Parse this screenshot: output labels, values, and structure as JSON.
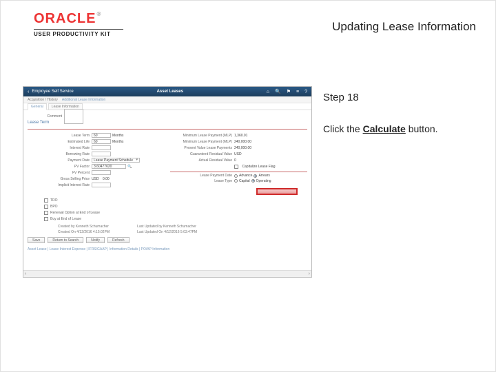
{
  "brand": {
    "name": "ORACLE",
    "tm": "®",
    "subtitle": "USER PRODUCTIVITY KIT"
  },
  "doc_title": "Updating Lease Information",
  "step_label": "Step 18",
  "instruction": {
    "prefix": "Click the ",
    "strong": "Calculate",
    "suffix": " button."
  },
  "app": {
    "header": {
      "back": "‹",
      "title_left": "Employee Self Service",
      "title_center": "Asset Leases",
      "icons": {
        "home": "⌂",
        "search": "🔍",
        "flag": "⚑",
        "menu": "≡",
        "help": "?"
      }
    },
    "sub_row": {
      "breadcrumb": "Acquisition / History",
      "link": "Additional Lease Information"
    },
    "tabs": {
      "t1": "General",
      "t2": "Lease Information"
    },
    "section": {
      "comment_label": "Comment",
      "lease_term_label": "Lease Term"
    },
    "left_fields": {
      "lease_term": {
        "label": "Lease Term",
        "value": "60",
        "unit": "Months"
      },
      "est_life": {
        "label": "Estimated Life",
        "value": "60",
        "unit": "Months"
      },
      "interest_rate": {
        "label": "Interest Rate"
      },
      "borrowing_rate": {
        "label": "Borrowing Rate"
      },
      "payment_date": {
        "label": "Payment Date",
        "option": "Lease Payment Schedule"
      },
      "pv_factor": {
        "label": "PV Factor",
        "value": "3.60477620"
      },
      "fv_percent": {
        "label": "FV Percent"
      },
      "gross_sel": {
        "label": "Gross Selling Price",
        "value": "USD",
        "amt": "0.00"
      },
      "implicit_ir": {
        "label": "Implicit Interest Rate"
      }
    },
    "right_fields": {
      "min_payment": {
        "label": "Minimum Lease Payment (MLP)",
        "value": "1,360.01"
      },
      "min_payment_mlp": {
        "label": "Minimum Lease Payment (MLP)",
        "value": "240,000.00"
      },
      "present_value": {
        "label": "Present Value Lease Payments",
        "value": "240,000.00"
      },
      "guaranteed_residual": {
        "label": "Guaranteed Residual Value",
        "value": "USD"
      },
      "actual_residual": {
        "label": "Actual Residual Value",
        "value": "0"
      },
      "capitalize": {
        "label": "Capitalize Lease Flag"
      },
      "lease_payment_toggle": {
        "label": "Lease Payment Date",
        "opt1": "Advance",
        "opt2": "Arrears"
      },
      "lease_type": {
        "label": "Lease Type",
        "opt1": "Capital",
        "opt2": "Operating"
      }
    },
    "checkboxes": {
      "tro": "TRO",
      "bpo": "BPO",
      "renewal": "Renewal Option at End of Lease",
      "buy": "Buy at End of Lease"
    },
    "meta": {
      "created_by_label": "Created by",
      "created_by": "Kenneth Schumacher",
      "created_on_label": "Created On",
      "created_on": "4/12/2016  4:15:02PM",
      "last_upd_by_label": "Last Updated by",
      "last_upd_by": "Kenneth Schumacher",
      "last_upd_on_label": "Last Updated On",
      "last_upd_on": "4/12/2016  5:03:47PM"
    },
    "buttons": {
      "save": "Save",
      "return": "Return to Search",
      "notify": "Notify",
      "refresh": "Refresh"
    },
    "route": "Asset Lease | Lease Interest Expense | IFRS/GAAP | Information Details | PO/AP Information",
    "scroll": {
      "left": "‹",
      "right": "›"
    }
  }
}
